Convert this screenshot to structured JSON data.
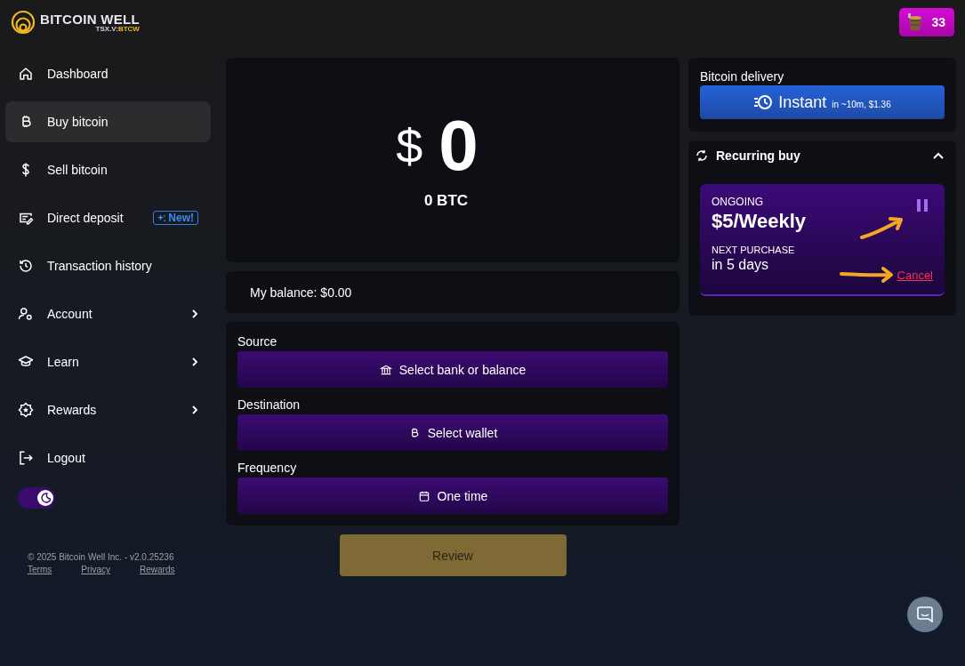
{
  "brand": {
    "name": "BITCOIN WELL",
    "exchange": "TSX.V:",
    "ticker": "BTCW"
  },
  "rewards_badge": {
    "count": "33"
  },
  "sidebar": {
    "items": [
      {
        "label": "Dashboard",
        "selected": false,
        "submenu": false
      },
      {
        "label": "Buy bitcoin",
        "selected": true,
        "submenu": false
      },
      {
        "label": "Sell bitcoin",
        "selected": false,
        "submenu": false
      },
      {
        "label": "Direct deposit",
        "selected": false,
        "submenu": false,
        "badge": "New!"
      },
      {
        "label": "Transaction history",
        "selected": false,
        "submenu": false
      },
      {
        "label": "Account",
        "selected": false,
        "submenu": true
      },
      {
        "label": "Learn",
        "selected": false,
        "submenu": true
      },
      {
        "label": "Rewards",
        "selected": false,
        "submenu": true
      },
      {
        "label": "Logout",
        "selected": false,
        "submenu": false
      }
    ],
    "dark_mode": {
      "on": true
    }
  },
  "footer": {
    "copyright": "© 2025 Bitcoin Well Inc. - v2.0.25236",
    "links": [
      "Terms",
      "Privacy",
      "Rewards"
    ]
  },
  "amount": {
    "currency": "$",
    "value": "0",
    "btc": "0 BTC"
  },
  "balance": "My balance: $0.00",
  "fields": [
    {
      "label": "Source",
      "value": "Select bank or balance"
    },
    {
      "label": "Destination",
      "value": "Select wallet"
    },
    {
      "label": "Frequency",
      "value": "One time"
    }
  ],
  "review_button": {
    "label": "Review",
    "disabled": true
  },
  "delivery": {
    "title": "Bitcoin delivery",
    "option": "Instant",
    "detail": "in ~10m, $1.36"
  },
  "recurring": {
    "title": "Recurring buy",
    "expanded": true,
    "status": "ONGOING",
    "plan": "$5/Weekly",
    "next_label": "NEXT PURCHASE",
    "next_value": "in 5 days",
    "cancel": "Cancel"
  },
  "annotations": [
    {
      "kind": "diagonal"
    },
    {
      "kind": "horizontal"
    }
  ]
}
